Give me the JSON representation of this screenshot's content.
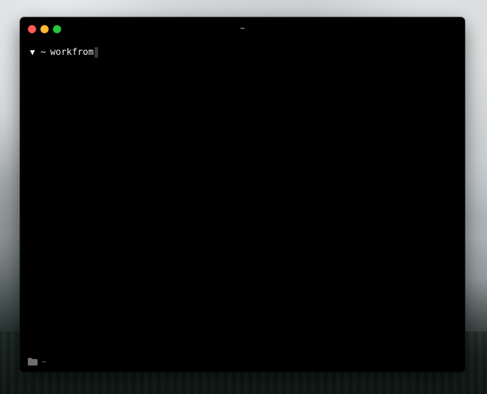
{
  "window": {
    "title": "~"
  },
  "terminal": {
    "prompt_symbol": "▼",
    "cwd": "~",
    "command": "workfrom"
  },
  "statusbar": {
    "icon": "folder-icon",
    "path": "~"
  },
  "colors": {
    "terminal_background": "#000000",
    "close_button": "#ff5f57",
    "minimize_button": "#febc2e",
    "maximize_button": "#28c840",
    "text": "#f2f2f2",
    "status_text": "#7c7c7c"
  }
}
